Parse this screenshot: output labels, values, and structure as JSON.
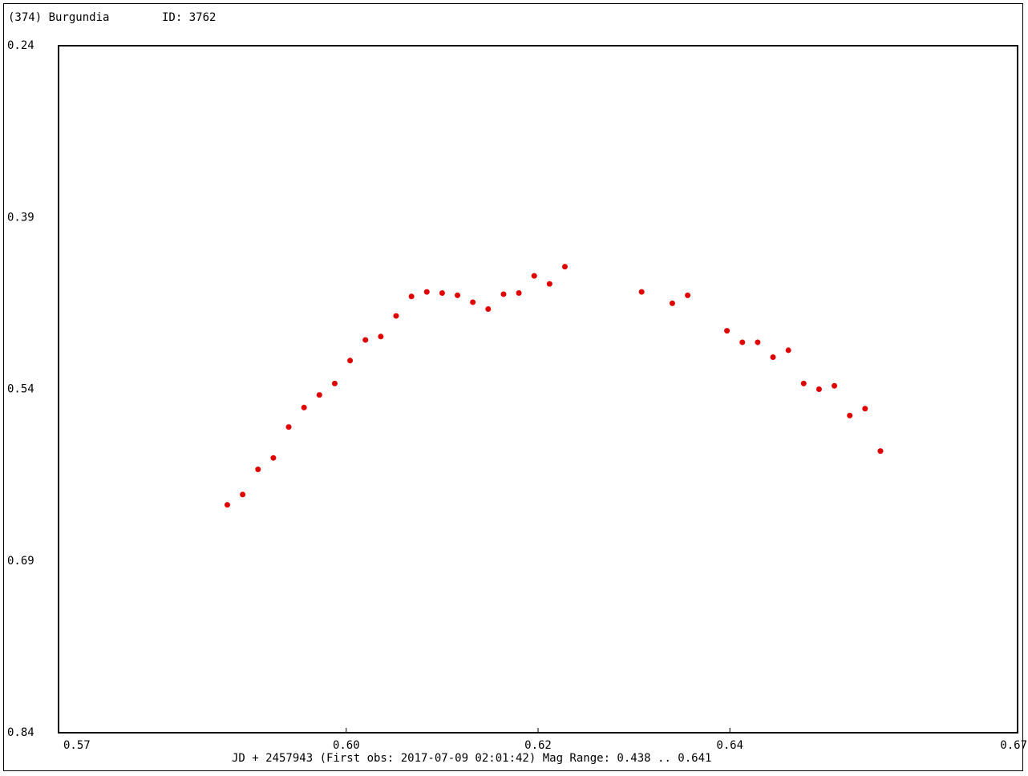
{
  "header": {
    "object": "(374) Burgundia",
    "id": "ID: 3762"
  },
  "footer": {
    "caption": "JD + 2457943  (First obs: 2017-07-09 02:01:42)  Mag Range: 0.438 .. 0.641"
  },
  "chart_data": {
    "type": "scatter",
    "title": "",
    "xlabel": "JD + 2457943",
    "ylabel": "",
    "xlim": [
      0.57,
      0.67
    ],
    "ylim": [
      0.24,
      0.84
    ],
    "y_inverted": true,
    "xticks": [
      0.57,
      0.6,
      0.62,
      0.64,
      0.67
    ],
    "xtick_labels": [
      "0.57",
      "0.60",
      "0.62",
      "0.64",
      "0.67"
    ],
    "yticks": [
      0.24,
      0.39,
      0.54,
      0.69,
      0.84
    ],
    "ytick_labels": [
      "0.24",
      "0.39",
      "0.54",
      "0.69",
      "0.84"
    ],
    "marker_color": "#e00000",
    "series": [
      {
        "points": [
          [
            0.5876,
            0.641
          ],
          [
            0.5892,
            0.632
          ],
          [
            0.5908,
            0.61
          ],
          [
            0.5924,
            0.6
          ],
          [
            0.594,
            0.573
          ],
          [
            0.5956,
            0.556
          ],
          [
            0.5972,
            0.545
          ],
          [
            0.5988,
            0.535
          ],
          [
            0.6004,
            0.515
          ],
          [
            0.602,
            0.497
          ],
          [
            0.6036,
            0.494
          ],
          [
            0.6052,
            0.476
          ],
          [
            0.6068,
            0.459
          ],
          [
            0.6084,
            0.455
          ],
          [
            0.61,
            0.456
          ],
          [
            0.6116,
            0.458
          ],
          [
            0.6132,
            0.464
          ],
          [
            0.6148,
            0.47
          ],
          [
            0.6164,
            0.457
          ],
          [
            0.618,
            0.456
          ],
          [
            0.6196,
            0.441
          ],
          [
            0.6212,
            0.448
          ],
          [
            0.6228,
            0.433
          ],
          [
            0.6308,
            0.455
          ],
          [
            0.634,
            0.465
          ],
          [
            0.6356,
            0.458
          ],
          [
            0.6397,
            0.489
          ],
          [
            0.6413,
            0.499
          ],
          [
            0.6429,
            0.499
          ],
          [
            0.6445,
            0.512
          ],
          [
            0.6461,
            0.506
          ],
          [
            0.6477,
            0.535
          ],
          [
            0.6493,
            0.54
          ],
          [
            0.6509,
            0.537
          ],
          [
            0.6525,
            0.563
          ],
          [
            0.6541,
            0.557
          ],
          [
            0.6557,
            0.594
          ]
        ]
      }
    ]
  }
}
